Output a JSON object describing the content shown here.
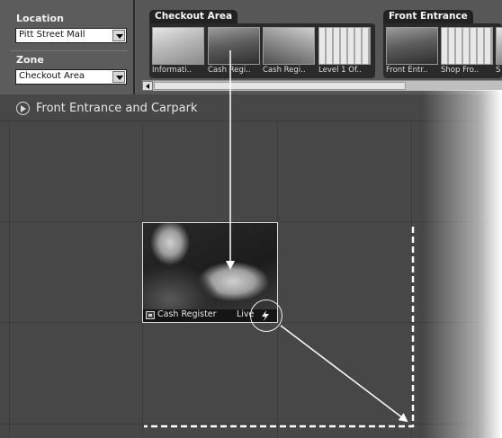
{
  "sidebar": {
    "location": {
      "label": "Location",
      "value": "Pitt Street Mall"
    },
    "zone": {
      "label": "Zone",
      "value": "Checkout Area"
    }
  },
  "camera_strip": {
    "groups": [
      {
        "title": "Checkout Area",
        "cameras": [
          {
            "label": "Informati..",
            "icon": "camera-thumbnail-light"
          },
          {
            "label": "Cash Regi..",
            "icon": "camera-thumbnail-dark"
          },
          {
            "label": "Cash Regi..",
            "icon": "camera-thumbnail-mid"
          },
          {
            "label": "Level 1 Of..",
            "icon": "camera-thumbnail-windows"
          }
        ]
      },
      {
        "title": "Front Entrance",
        "cameras": [
          {
            "label": "Front Entr..",
            "icon": "camera-thumbnail-dark"
          },
          {
            "label": "Shop Fro..",
            "icon": "camera-thumbnail-windows"
          },
          {
            "label": "S",
            "icon": "camera-thumbnail-light"
          }
        ]
      }
    ]
  },
  "view": {
    "title": "Front Entrance and Carpark",
    "icon": "play-circle-icon"
  },
  "camera_tile": {
    "name": "Cash Register",
    "status": "Live",
    "icons": [
      "camera-icon",
      "lightning-icon"
    ]
  },
  "colors": {
    "panel": "#5b5b5b",
    "grid_background": "#474747",
    "grid_lines": "#3c3c3c",
    "annotation": "#ffffff"
  }
}
